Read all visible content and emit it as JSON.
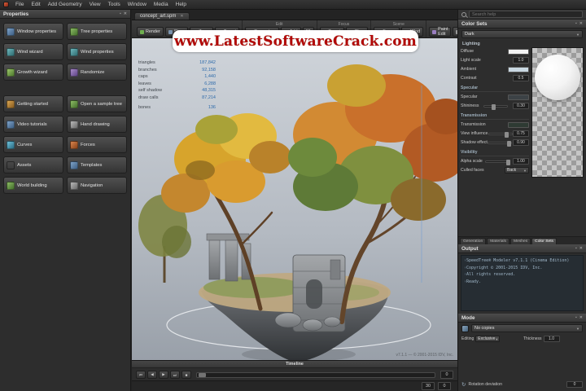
{
  "menu": {
    "items": [
      "File",
      "Edit",
      "Add Geometry",
      "View",
      "Tools",
      "Window",
      "Media",
      "Help"
    ]
  },
  "watermark": {
    "text": "www.LatestSoftwareCrack.com",
    "text_color": "#b20909",
    "bg_color": "#ffffff"
  },
  "left_panel": {
    "title": "Properties",
    "buttons": [
      {
        "label": "Window properties",
        "icon": "window-properties-icon"
      },
      {
        "label": "Tree properties",
        "icon": "tree-properties-icon"
      },
      {
        "label": "Wind wizard",
        "icon": "wind-wizard-icon"
      },
      {
        "label": "Wind properties",
        "icon": "wind-properties-icon"
      },
      {
        "label": "Growth wizard",
        "icon": "growth-wizard-icon"
      },
      {
        "label": "Randomize",
        "icon": "randomize-icon"
      },
      {
        "label": "Getting started",
        "icon": "getting-started-icon"
      },
      {
        "label": "Open a sample tree",
        "icon": "sample-tree-icon"
      },
      {
        "label": "Video tutorials",
        "icon": "video-tutorials-icon"
      },
      {
        "label": "Hand drawing",
        "icon": "hand-drawing-icon"
      },
      {
        "label": "Curves",
        "icon": "curves-icon"
      },
      {
        "label": "Forces",
        "icon": "forces-icon"
      },
      {
        "label": "Assets",
        "icon": "assets-icon"
      },
      {
        "label": "Templates",
        "icon": "templates-icon"
      },
      {
        "label": "World building",
        "icon": "world-building-icon"
      },
      {
        "label": "Navigation",
        "icon": "navigation-icon"
      }
    ]
  },
  "viewport": {
    "tab": "concept_art.spm",
    "toolbar": {
      "groups": [
        {
          "label": "",
          "buttons": [
            "Render",
            "Show",
            "Zoom",
            "Target"
          ]
        },
        {
          "label": "Edit",
          "buttons": [
            "Generators",
            "Add",
            "60"
          ]
        },
        {
          "label": "Focus",
          "buttons": [
            "Target",
            "Clear"
          ]
        },
        {
          "label": "Scene",
          "buttons": [
            "Forces",
            "Wind"
          ]
        },
        {
          "label": "Misc",
          "buttons": [
            "Paint Edit",
            "Tool",
            "Window"
          ]
        }
      ]
    },
    "stats": [
      {
        "k": "triangles",
        "v": "187,842"
      },
      {
        "k": "branches",
        "v": "92,158"
      },
      {
        "k": "caps",
        "v": "1,440"
      },
      {
        "k": "leaves",
        "v": "6,288"
      },
      {
        "k": "self shadow",
        "v": "48,315"
      },
      {
        "k": "draw calls",
        "v": "87,214"
      },
      {
        "k": "bones",
        "v": "136"
      }
    ],
    "caption": "v7.1.1 — © 2001-2015 IDV, Inc."
  },
  "timeline": {
    "title": "Timeline",
    "buttons": [
      "⏮",
      "◀",
      "▶",
      "⏭",
      "■"
    ],
    "frame": "0",
    "footer": {
      "fps": "30",
      "frame": "0"
    }
  },
  "right_panel": {
    "search": {
      "placeholder": "Search help"
    },
    "color_sets": {
      "title": "Color Sets",
      "preset": "Dark",
      "lighting_label": "Lighting",
      "diffuse": {
        "label": "Diffuse",
        "swatch": "#f2f2f2"
      },
      "light_scale": {
        "label": "Light scale",
        "value": "1.0"
      },
      "ambient": {
        "label": "Ambient",
        "swatch": "#c9d8e2"
      },
      "contrast": {
        "label": "Contrast",
        "value": "0.5"
      },
      "specular": {
        "title": "Specular",
        "color": {
          "label": "Specular",
          "swatch": "#3c4246"
        },
        "shininess": {
          "label": "Shininess",
          "value": "0.30"
        }
      },
      "transmission": {
        "title": "Transmission",
        "color": {
          "label": "Transmission",
          "swatch": "#2e3a33"
        },
        "view_influence": {
          "label": "View influence",
          "value": "0.75"
        },
        "shadow_effect": {
          "label": "Shadow effect",
          "value": "0.90"
        }
      },
      "visibility": {
        "title": "Visibility",
        "alpha_scale": {
          "label": "Alpha scale",
          "value": "1.00"
        },
        "culled_faces": {
          "label": "Culled faces",
          "value": "Back"
        }
      }
    },
    "tabs": [
      {
        "label": "Generation"
      },
      {
        "label": "Materials"
      },
      {
        "label": "Meshes"
      },
      {
        "label": "Color Sets"
      }
    ],
    "output": {
      "title": "Output",
      "lines": [
        "SpeedTree® Modeler v7.1.1 (Cinema Edition)",
        "Copyright © 2001-2015 IDV, Inc.",
        "All rights reserved.",
        "Ready."
      ]
    },
    "mode": {
      "title": "Mode",
      "dropdown": "No copies",
      "rows": [
        {
          "label": "Editing",
          "value": "Exclusive"
        },
        {
          "label": "Thickness",
          "value": "1.0"
        }
      ],
      "bottom": {
        "label": "Rotation deviation",
        "value": "0"
      }
    }
  }
}
